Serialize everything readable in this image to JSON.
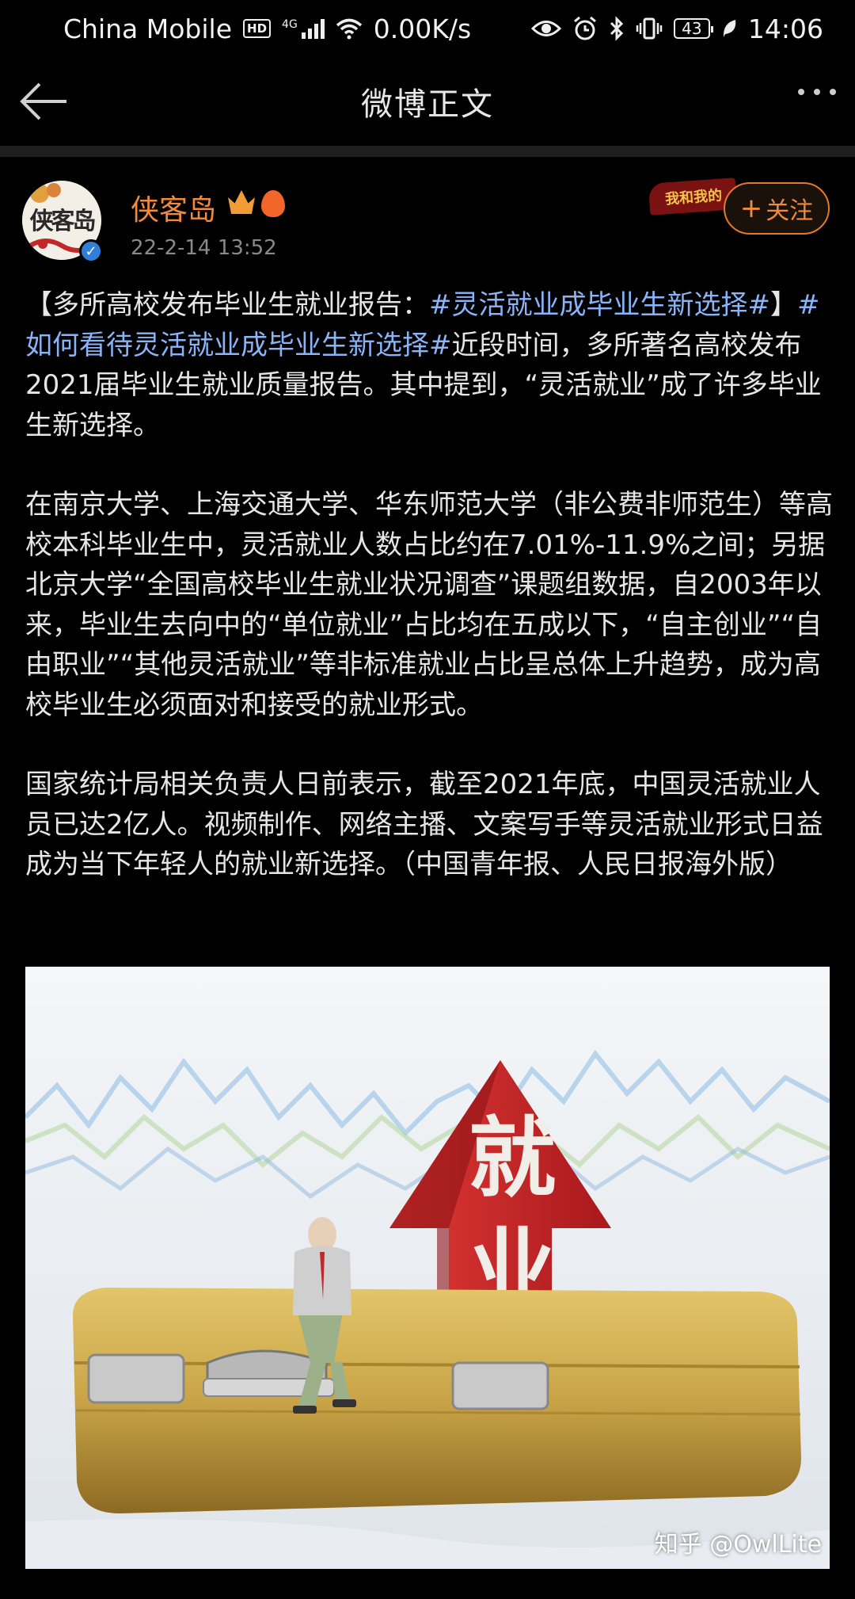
{
  "status_bar": {
    "carrier": "China Mobile",
    "hd": "HD",
    "network": "4G",
    "speed": "0.00K/s",
    "battery": "43",
    "time": "14:06"
  },
  "nav": {
    "title": "微博正文"
  },
  "author": {
    "name": "侠客岛",
    "avatar_text": "侠客岛",
    "time": "22-2-14 13:52",
    "follow_label": "关注",
    "follow_plus": "+",
    "deco_text": "我和我的"
  },
  "post": {
    "p1_start": "【多所高校发布毕业生就业报告：",
    "p1_tag1": "#灵活就业成毕业生新选择#",
    "p1_mid": "】",
    "p1_tag2": "#如何看待灵活就业成毕业生新选择#",
    "p1_end": "近段时间，多所著名高校发布2021届毕业生就业质量报告。其中提到，“灵活就业”成了许多毕业生新选择。",
    "p2": "在南京大学、上海交通大学、华东师范大学（非公费非师范生）等高校本科毕业生中，灵活就业人数占比约在7.01%-11.9%之间；另据北京大学“全国高校毕业生就业状况调查”课题组数据，自2003年以来，毕业生去向中的“单位就业”占比均在五成以下，“自主创业”“自由职业”“其他灵活就业”等非标准就业占比呈总体上升趋势，成为高校毕业生必须面对和接受的就业形式。",
    "p3": "国家统计局相关负责人日前表示，截至2021年底，中国灵活就业人员已达2亿人。视频制作、网络主播、文案写手等灵活就业形式日益成为当下年轻人的就业新选择。（中国青年报、人民日报海外版）"
  },
  "image": {
    "arrow_char1": "就",
    "arrow_char2": "业",
    "watermark": "知乎 @OwlLite"
  },
  "colors": {
    "author_name": "#f08a3c",
    "hashtag": "#8ab4f8",
    "arrow_red": "#c8262a",
    "briefcase_gold": "#c9a447"
  }
}
